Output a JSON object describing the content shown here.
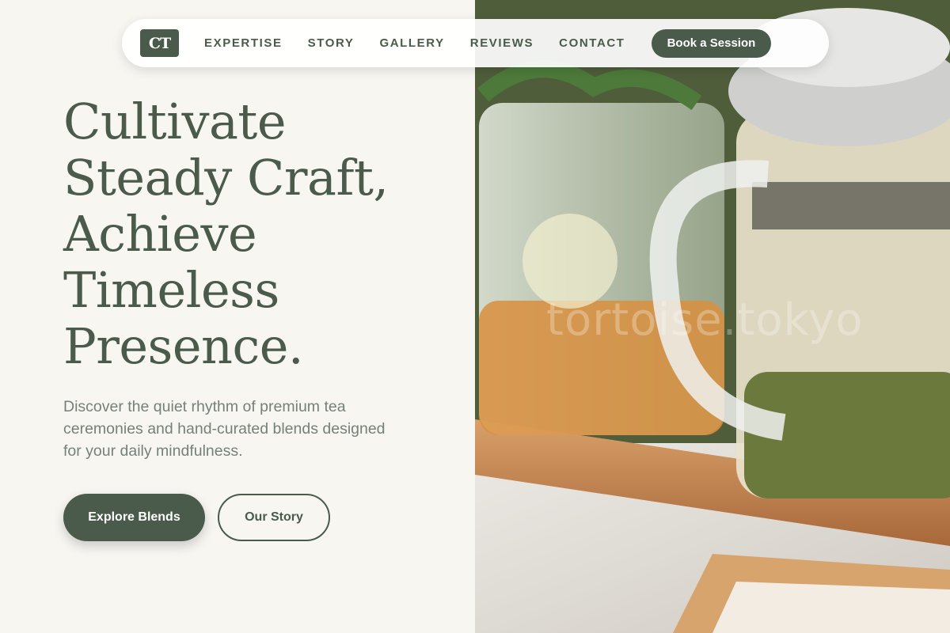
{
  "brand": {
    "logo_text": "CT"
  },
  "nav": {
    "links": [
      "EXPERTISE",
      "STORY",
      "GALLERY",
      "REVIEWS",
      "CONTACT"
    ],
    "cta_label": "Book a Session"
  },
  "hero": {
    "title_lines": [
      "Cultivate",
      "Steady Craft,",
      "Achieve",
      "Timeless",
      "Presence."
    ],
    "description": "Discover the quiet rhythm of premium tea ceremonies and hand-curated blends designed for your daily mindfulness.",
    "primary_label": "Explore Blends",
    "secondary_label": "Our Story",
    "watermark": "tortoise.tokyo"
  },
  "colors": {
    "accent": "#4a5a4b",
    "background": "#f7f6f1",
    "body_text": "#76807a"
  },
  "icons": {
    "image": "tea-photo"
  }
}
